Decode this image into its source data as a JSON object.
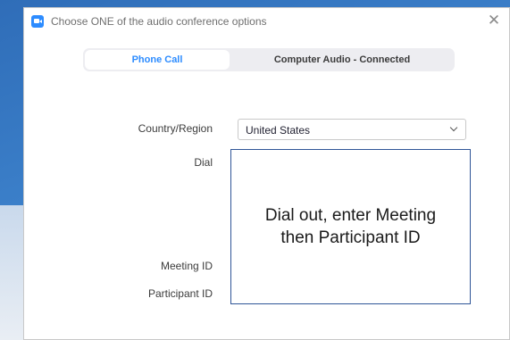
{
  "dialog": {
    "title": "Choose ONE of the audio conference options",
    "close_glyph": "✕",
    "app_icon": "zoom-camera-icon"
  },
  "tabs": [
    {
      "label": "Phone Call",
      "active": true
    },
    {
      "label": "Computer Audio - Connected",
      "active": false
    }
  ],
  "form": {
    "country_label": "Country/Region",
    "country_value": "United States",
    "dial_label": "Dial",
    "meeting_id_label": "Meeting ID",
    "participant_id_label": "Participant ID"
  },
  "callout": {
    "text": "Dial out, enter Meeting then Participant ID"
  },
  "colors": {
    "accent": "#2d8cff",
    "callout_border": "#2f5597",
    "desktop": "#2f6db8"
  }
}
